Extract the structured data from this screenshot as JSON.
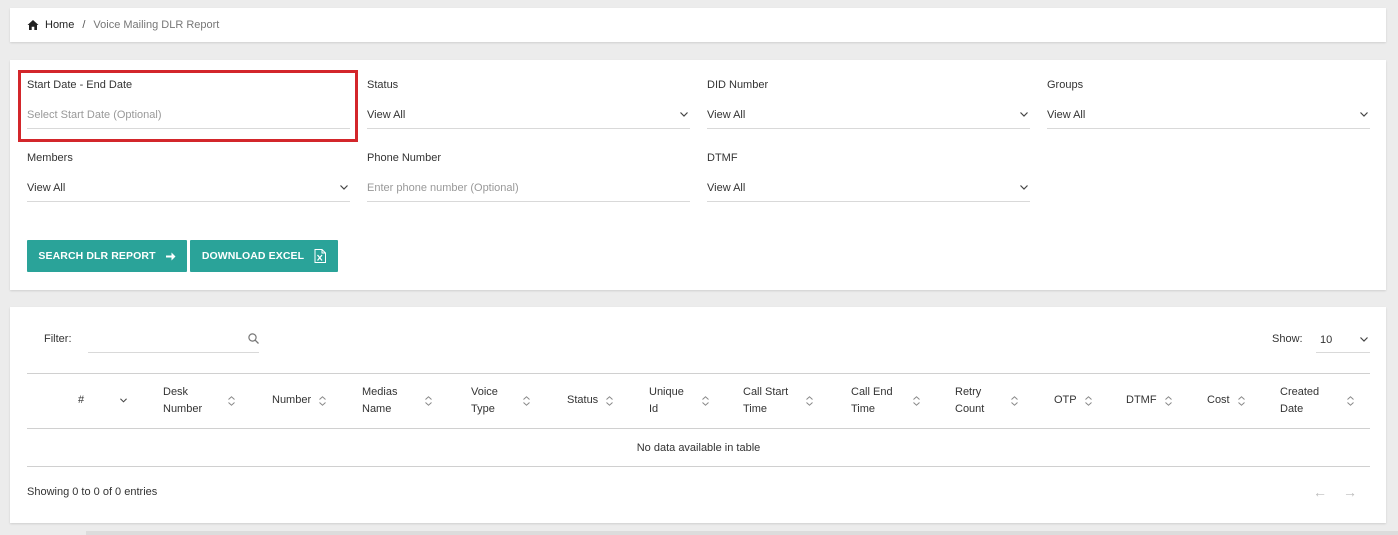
{
  "breadcrumb": {
    "home": "Home",
    "separator": "/",
    "current": "Voice Mailing DLR Report"
  },
  "filters": {
    "date": {
      "label": "Start Date - End Date",
      "placeholder": "Select Start Date (Optional)"
    },
    "status": {
      "label": "Status",
      "value": "View All"
    },
    "did": {
      "label": "DID Number",
      "value": "View All"
    },
    "groups": {
      "label": "Groups",
      "value": "View All"
    },
    "members": {
      "label": "Members",
      "value": "View All"
    },
    "phone": {
      "label": "Phone Number",
      "placeholder": "Enter phone number (Optional)"
    },
    "dtmf": {
      "label": "DTMF",
      "value": "View All"
    }
  },
  "buttons": {
    "search": "SEARCH DLR REPORT",
    "excel": "DOWNLOAD EXCEL"
  },
  "table": {
    "filter_label": "Filter:",
    "show_label": "Show:",
    "show_value": "10",
    "columns": [
      "#",
      "Desk\nNumber",
      "Number",
      "Medias\nName",
      "Voice\nType",
      "Status",
      "Unique\nId",
      "Call Start\nTime",
      "Call End\nTime",
      "Retry\nCount",
      "OTP",
      "DTMF",
      "Cost",
      "Created\nDate"
    ],
    "empty_message": "No data available in table",
    "info": "Showing 0 to 0 of 0 entries",
    "prev": "←",
    "next": "→"
  },
  "colors": {
    "accent": "#2aa399",
    "highlight": "#d3262b",
    "background": "#ececec"
  },
  "icons": [
    "home-icon",
    "chevron-down-icon",
    "arrow-right-icon",
    "excel-file-icon",
    "search-icon",
    "sort-icon"
  ]
}
